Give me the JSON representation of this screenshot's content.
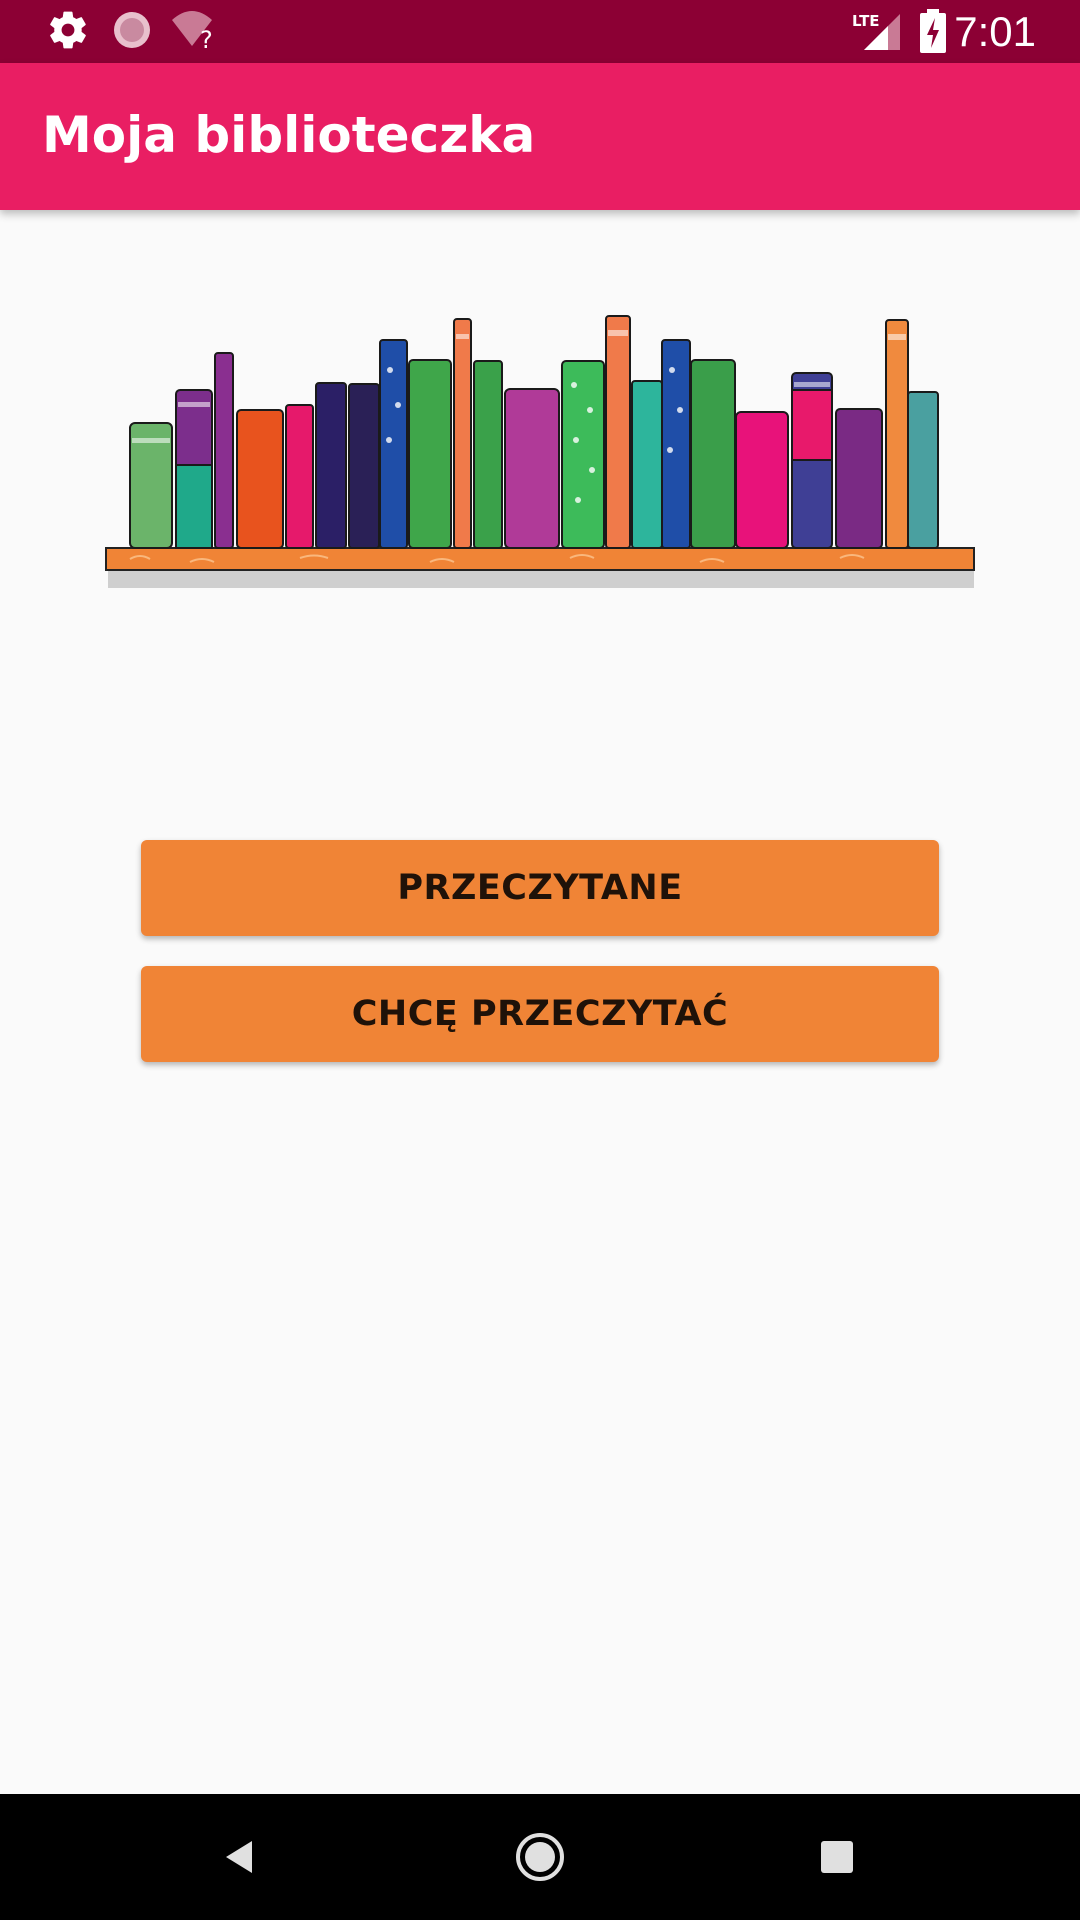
{
  "status_bar": {
    "time": "7:01",
    "network": "LTE",
    "icons": [
      "settings-icon",
      "sync-icon",
      "wifi-unknown-icon",
      "lte-signal-icon",
      "battery-charging-icon"
    ]
  },
  "app_bar": {
    "title": "Moja biblioteczka"
  },
  "hero": {
    "image": "bookshelf-illustration"
  },
  "buttons": {
    "read": "PRZECZYTANE",
    "want_to_read": "CHCĘ PRZECZYTAĆ"
  },
  "colors": {
    "status_bar": "#8c0034",
    "app_bar": "#e91e63",
    "button": "#f08436",
    "background": "#fafafa"
  },
  "nav_bar": {
    "icons": [
      "back-icon",
      "home-icon",
      "recents-icon"
    ]
  }
}
